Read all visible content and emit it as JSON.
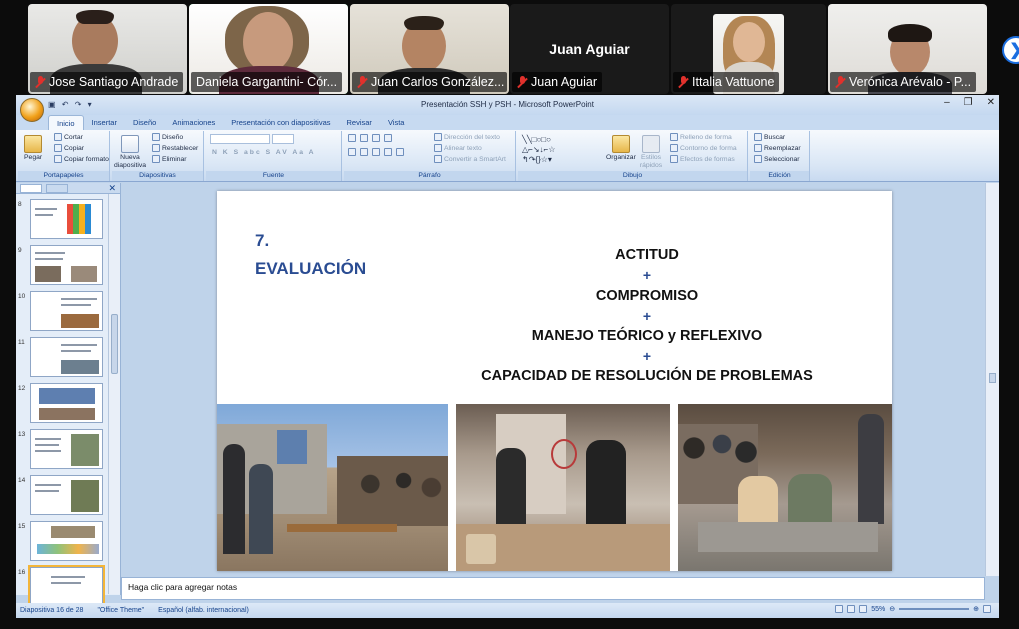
{
  "participants": [
    {
      "name": "Jose Santiago Andrade",
      "muted": true
    },
    {
      "name": "Daniela Gargantini- Cór...",
      "muted": false,
      "active": true
    },
    {
      "name": "Juan Carlos González...",
      "muted": true
    },
    {
      "name": "Juan Aguiar",
      "muted": true,
      "video_off": true
    },
    {
      "name": "Ittalia Vattuone",
      "muted": true
    },
    {
      "name": "Verónica Arévalo - P...",
      "muted": true
    }
  ],
  "next_page_arrow": "❯",
  "window": {
    "title": "Presentación SSH y PSH - Microsoft PowerPoint",
    "controls": [
      "–",
      "❐",
      "✕"
    ]
  },
  "ribbon": {
    "tabs": [
      "Inicio",
      "Insertar",
      "Diseño",
      "Animaciones",
      "Presentación con diapositivas",
      "Revisar",
      "Vista"
    ],
    "active_tab": "Inicio",
    "groups": {
      "portapapeles": {
        "name": "Portapapeles",
        "pegar": "Pegar",
        "cortar": "Cortar",
        "copiar": "Copiar",
        "copiar_formato": "Copiar formato"
      },
      "diapositivas": {
        "name": "Diapositivas",
        "nueva": "Nueva diapositiva",
        "diseno": "Diseño",
        "restablecer": "Restablecer",
        "eliminar": "Eliminar"
      },
      "fuente": {
        "name": "Fuente",
        "buttons": "N K S abc S AV Aa A"
      },
      "parrafo": {
        "name": "Párrafo",
        "direccion": "Dirección del texto",
        "alinear": "Alinear texto",
        "smartart": "Convertir a SmartArt"
      },
      "dibujo": {
        "name": "Dibujo",
        "organizar": "Organizar",
        "estilos": "Estilos rápidos",
        "relleno": "Relleno de forma",
        "contorno": "Contorno de forma",
        "efectos": "Efectos de formas"
      },
      "edicion": {
        "name": "Edición",
        "buscar": "Buscar",
        "reemplazar": "Reemplazar",
        "seleccionar": "Seleccionar"
      }
    }
  },
  "slide_panel": {
    "thumbnails": [
      {
        "num": "8"
      },
      {
        "num": "9"
      },
      {
        "num": "10"
      },
      {
        "num": "11"
      },
      {
        "num": "12"
      },
      {
        "num": "13"
      },
      {
        "num": "14"
      },
      {
        "num": "15"
      },
      {
        "num": "16",
        "selected": true
      }
    ]
  },
  "slide": {
    "number": "7.",
    "title": "EVALUACIÓN",
    "criteria": [
      "ACTITUD",
      "COMPROMISO",
      "MANEJO TEÓRICO y REFLEXIVO",
      "CAPACIDAD DE RESOLUCIÓN DE PROBLEMAS"
    ],
    "plus": "+"
  },
  "notes_placeholder": "Haga clic para agregar notas",
  "status_bar": {
    "slide_info": "Diapositiva 16 de 28",
    "theme": "\"Office Theme\"",
    "language": "Español (alfab. internacional)",
    "zoom": "55%"
  },
  "colors": {
    "accent_blue": "#2a4c92",
    "active_speaker": "#1ec765",
    "muted_red": "#e0312c"
  }
}
